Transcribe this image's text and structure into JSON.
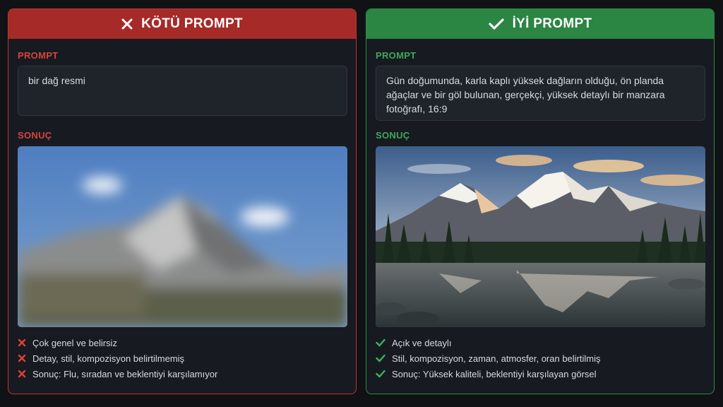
{
  "bad": {
    "title": "KÖTÜ PROMPT",
    "prompt_label": "PROMPT",
    "prompt_text": "bir dağ resmi",
    "result_label": "SONUÇ",
    "points": [
      "Çok genel ve belirsiz",
      "Detay, stil, kompozisyon belirtilmemiş",
      "Sonuç: Flu, sıradan ve beklentiyi karşılamıyor"
    ],
    "icon": "close-icon",
    "accent": "#a62a27"
  },
  "good": {
    "title": "İYİ PROMPT",
    "prompt_label": "PROMPT",
    "prompt_text": "Gün doğumunda, karla kaplı yüksek dağların olduğu, ön planda ağaçlar ve bir göl bulunan, gerçekçi, yüksek detaylı bir manzara fotoğrafı, 16:9",
    "result_label": "SONUÇ",
    "points": [
      "Açık ve detaylı",
      "Stil, kompozisyon, zaman, atmosfer, oran belirtilmiş",
      "Sonuç: Yüksek kaliteli, beklentiyi karşılayan görsel"
    ],
    "icon": "check-icon",
    "accent": "#2b8543"
  }
}
